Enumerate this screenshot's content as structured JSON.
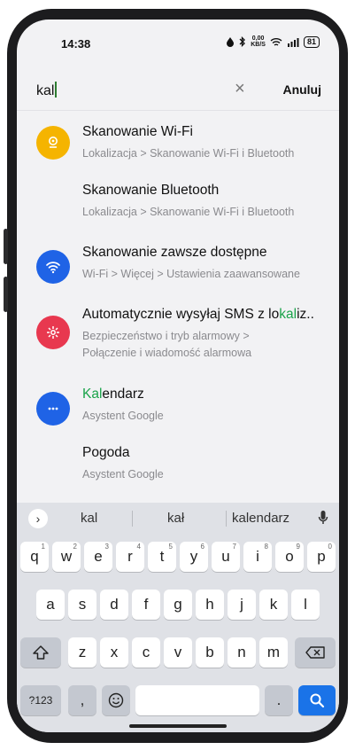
{
  "status_bar": {
    "time": "14:38",
    "net_speed_top": "0,00",
    "net_speed_bottom": "KB/S",
    "battery": "81"
  },
  "search": {
    "query": "kal",
    "clear_icon": "close-icon",
    "cancel_label": "Anuluj"
  },
  "results": [
    {
      "icon": "location-icon",
      "icon_color": "#f5b400",
      "title_before": "Skanowanie Wi-Fi",
      "title_hl": "",
      "title_after": "",
      "subtitle": [
        "Lokalizacja > Skanowanie Wi-Fi i Bluetooth"
      ]
    },
    {
      "icon": "",
      "icon_color": "",
      "title_before": "Skanowanie Bluetooth",
      "title_hl": "",
      "title_after": "",
      "subtitle": [
        "Lokalizacja > Skanowanie Wi-Fi i Bluetooth"
      ]
    },
    {
      "icon": "wifi-icon",
      "icon_color": "#1f63e6",
      "title_before": "Skanowanie zawsze dostępne",
      "title_hl": "",
      "title_after": "",
      "subtitle": [
        "Wi-Fi > Więcej > Ustawienia zaawansowane"
      ]
    },
    {
      "icon": "emergency-icon",
      "icon_color": "#e8384f",
      "title_before": "Automatycznie wysyłaj SMS z lo",
      "title_hl": "kal",
      "title_after": "iz..",
      "subtitle": [
        "Bezpieczeństwo i tryb alarmowy >",
        "Połączenie i wiadomość alarmowa"
      ]
    },
    {
      "icon": "more-icon",
      "icon_color": "#1f63e6",
      "title_before": "",
      "title_hl": "Kal",
      "title_after": "endarz",
      "subtitle": [
        "Asystent Google"
      ]
    },
    {
      "icon": "",
      "icon_color": "",
      "title_before": "Pogoda",
      "title_hl": "",
      "title_after": "",
      "subtitle": [
        "Asystent Google"
      ]
    }
  ],
  "keyboard": {
    "suggestions": [
      "kal",
      "kał",
      "kalendarz"
    ],
    "row1": [
      {
        "k": "q",
        "h": "1"
      },
      {
        "k": "w",
        "h": "2"
      },
      {
        "k": "e",
        "h": "3"
      },
      {
        "k": "r",
        "h": "4"
      },
      {
        "k": "t",
        "h": "5"
      },
      {
        "k": "y",
        "h": "6"
      },
      {
        "k": "u",
        "h": "7"
      },
      {
        "k": "i",
        "h": "8"
      },
      {
        "k": "o",
        "h": "9"
      },
      {
        "k": "p",
        "h": "0"
      }
    ],
    "row2": [
      "a",
      "s",
      "d",
      "f",
      "g",
      "h",
      "j",
      "k",
      "l"
    ],
    "row3": [
      "z",
      "x",
      "c",
      "v",
      "b",
      "n",
      "m"
    ],
    "symbols_label": "?123",
    "comma_label": ",",
    "period_label": "."
  }
}
